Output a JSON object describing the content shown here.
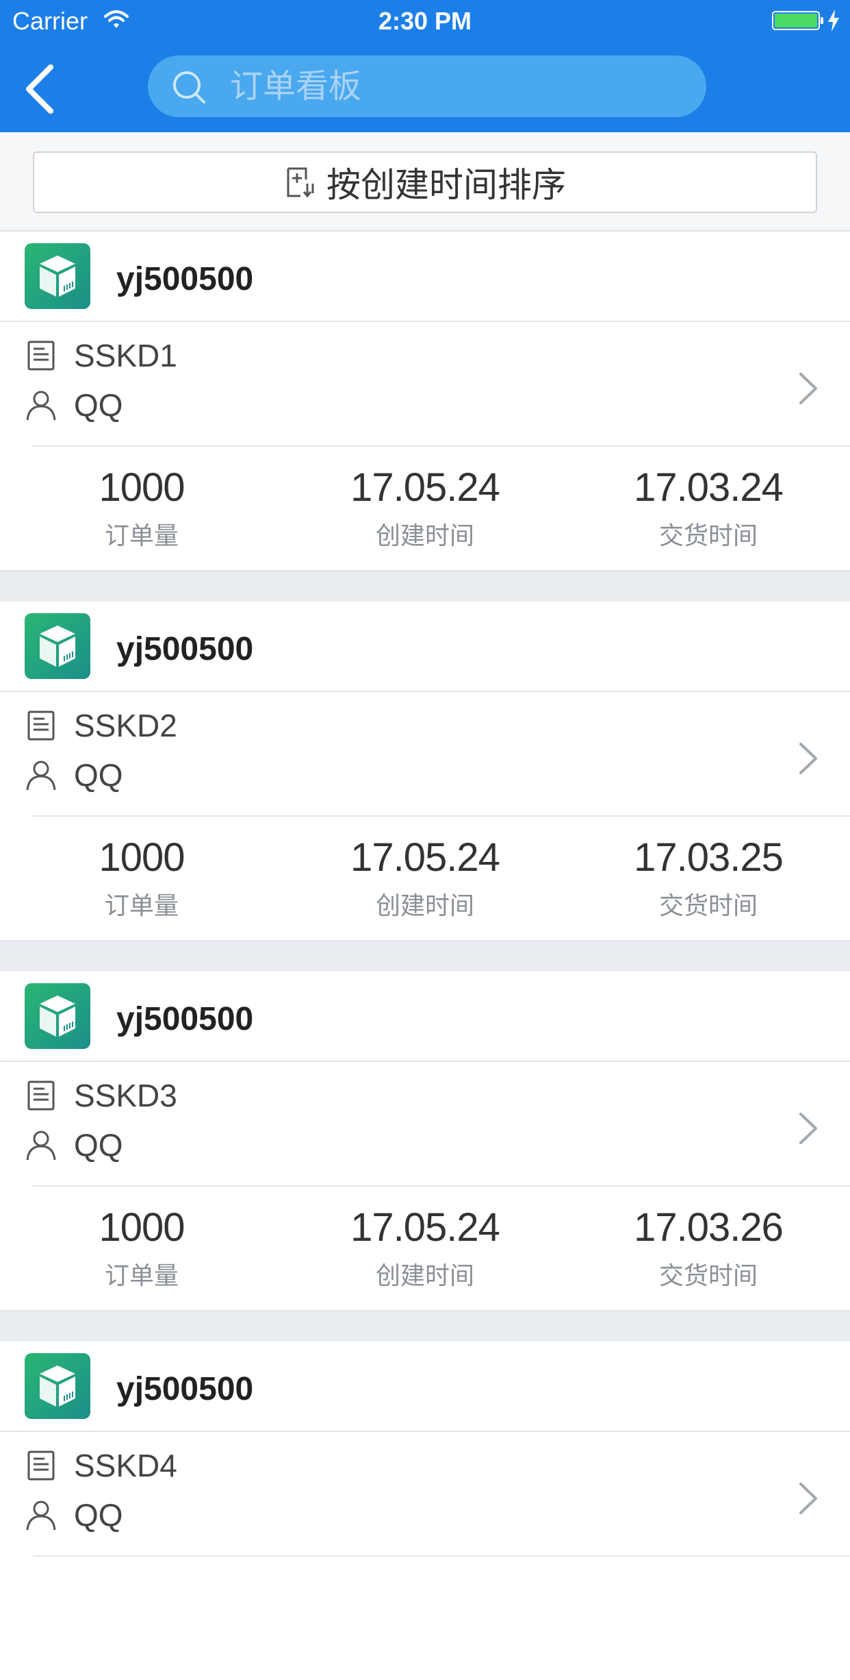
{
  "status_bar": {
    "carrier": "Carrier",
    "time": "2:30 PM",
    "battery_color": "#4cd964"
  },
  "nav": {
    "background": "#1c7fe8",
    "back_icon": "chevron-left-icon",
    "search_placeholder": "订单看板",
    "search_icon": "search-icon"
  },
  "sort": {
    "label": "按创建时间排序",
    "icon": "sort-add-icon"
  },
  "orders": [
    {
      "company": "yj500500",
      "order_no": "SSKD1",
      "contact": "QQ",
      "quantity": "1000",
      "quantity_label": "订单量",
      "created": "17.05.24",
      "created_label": "创建时间",
      "delivery": "17.03.24",
      "delivery_label": "交货时间"
    },
    {
      "company": "yj500500",
      "order_no": "SSKD2",
      "contact": "QQ",
      "quantity": "1000",
      "quantity_label": "订单量",
      "created": "17.05.24",
      "created_label": "创建时间",
      "delivery": "17.03.25",
      "delivery_label": "交货时间"
    },
    {
      "company": "yj500500",
      "order_no": "SSKD3",
      "contact": "QQ",
      "quantity": "1000",
      "quantity_label": "订单量",
      "created": "17.05.24",
      "created_label": "创建时间",
      "delivery": "17.03.26",
      "delivery_label": "交货时间"
    },
    {
      "company": "yj500500",
      "order_no": "SSKD4",
      "contact": "QQ",
      "quantity": "",
      "quantity_label": "",
      "created": "",
      "created_label": "",
      "delivery": "",
      "delivery_label": ""
    }
  ]
}
